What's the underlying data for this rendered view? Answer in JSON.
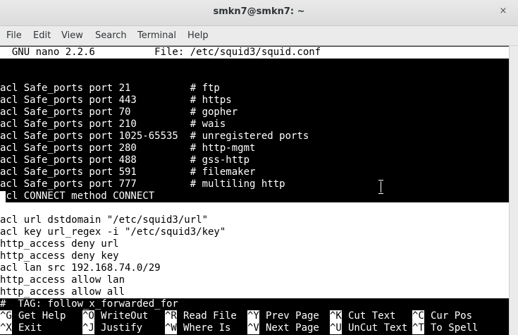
{
  "window": {
    "title": "smkn7@smkn7: ~",
    "close_glyph": "×"
  },
  "menu": [
    "File",
    "Edit",
    "View",
    "Search",
    "Terminal",
    "Help"
  ],
  "nano": {
    "header": "  GNU nano 2.2.6          File: /etc/squid3/squid.conf",
    "lines": [
      {
        "text": "",
        "inverted": false
      },
      {
        "text": "acl Safe_ports port 21          # ftp",
        "inverted": false
      },
      {
        "text": "acl Safe_ports port 443         # https",
        "inverted": false
      },
      {
        "text": "acl Safe_ports port 70          # gopher",
        "inverted": false
      },
      {
        "text": "acl Safe_ports port 210         # wais",
        "inverted": false
      },
      {
        "text": "acl Safe_ports port 1025-65535  # unregistered ports",
        "inverted": false
      },
      {
        "text": "acl Safe_ports port 280         # http-mgmt",
        "inverted": false
      },
      {
        "text": "acl Safe_ports port 488         # gss-http",
        "inverted": false
      },
      {
        "text": "acl Safe_ports port 591         # filemaker",
        "inverted": false
      },
      {
        "text": "acl Safe_ports port 777         # multiling http",
        "inverted": false
      },
      {
        "text": "acl CONNECT method CONNECT",
        "inverted": false
      },
      {
        "text": "",
        "inverted": true
      },
      {
        "text": "acl url dstdomain \"/etc/squid3/url\"",
        "inverted": true
      },
      {
        "text": "acl key url_regex -i \"/etc/squid3/key\"",
        "inverted": true
      },
      {
        "text": "http_access deny url",
        "inverted": true
      },
      {
        "text": "http_access deny key",
        "inverted": true
      },
      {
        "text": "acl lan src 192.168.74.0/29",
        "inverted": true
      },
      {
        "text": "http_access allow lan",
        "inverted": true
      },
      {
        "text": "http_access allow all",
        "inverted": true
      },
      {
        "text": "#  TAG: follow_x_forwarded_for",
        "inverted": false
      }
    ],
    "shortcuts_row1": [
      {
        "key": "^G",
        "label": "Get Help"
      },
      {
        "key": "^O",
        "label": "WriteOut"
      },
      {
        "key": "^R",
        "label": "Read File"
      },
      {
        "key": "^Y",
        "label": "Prev Page"
      },
      {
        "key": "^K",
        "label": "Cut Text"
      },
      {
        "key": "^C",
        "label": "Cur Pos"
      }
    ],
    "shortcuts_row2": [
      {
        "key": "^X",
        "label": "Exit"
      },
      {
        "key": "^J",
        "label": "Justify"
      },
      {
        "key": "^W",
        "label": "Where Is"
      },
      {
        "key": "^V",
        "label": "Next Page"
      },
      {
        "key": "^U",
        "label": "UnCut Text"
      },
      {
        "key": "^T",
        "label": "To Spell"
      }
    ]
  }
}
